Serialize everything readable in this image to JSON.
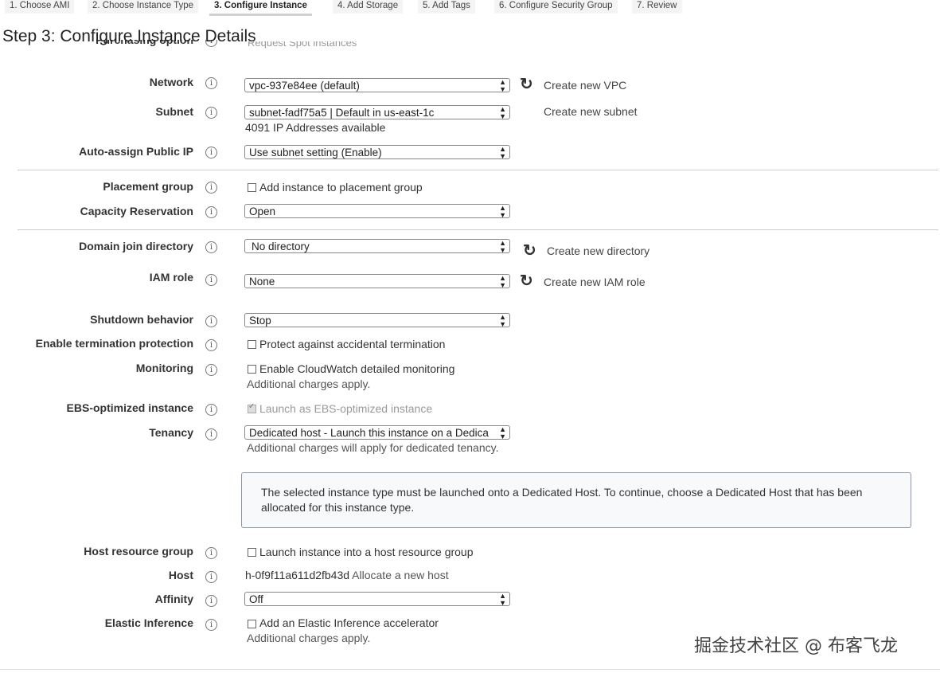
{
  "tabs": [
    {
      "label": "1. Choose AMI"
    },
    {
      "label": "2. Choose Instance Type"
    },
    {
      "label": "3. Configure Instance"
    },
    {
      "label": "4. Add Storage"
    },
    {
      "label": "5. Add Tags"
    },
    {
      "label": "6. Configure Security Group"
    },
    {
      "label": "7. Review"
    }
  ],
  "page": {
    "title": "Step 3: Configure Instance Details",
    "cut_label": "Purchasing option",
    "cut_checkbox": "Request Spot instances"
  },
  "network": {
    "label": "Network",
    "value": "vpc-937e84ee (default)",
    "link": "Create new VPC"
  },
  "subnet": {
    "label": "Subnet",
    "value": "subnet-fadf75a5 | Default in us-east-1c",
    "link": "Create new subnet",
    "note": "4091 IP Addresses available"
  },
  "public_ip": {
    "label": "Auto-assign Public IP",
    "value": "Use subnet setting (Enable)"
  },
  "placement": {
    "label": "Placement group",
    "checkbox": "Add instance to placement group"
  },
  "capacity": {
    "label": "Capacity Reservation",
    "value": "Open"
  },
  "domain": {
    "label": "Domain join directory",
    "value": "No directory",
    "link": "Create new directory"
  },
  "iam": {
    "label": "IAM role",
    "value": "None",
    "link": "Create new IAM role"
  },
  "shutdown": {
    "label": "Shutdown behavior",
    "value": "Stop"
  },
  "termination": {
    "label": "Enable termination protection",
    "checkbox": "Protect against accidental termination"
  },
  "monitoring": {
    "label": "Monitoring",
    "checkbox": "Enable CloudWatch detailed monitoring",
    "note": "Additional charges apply."
  },
  "ebs": {
    "label": "EBS-optimized instance",
    "checkbox": "Launch as EBS-optimized instance",
    "checked": true
  },
  "tenancy": {
    "label": "Tenancy",
    "value": "Dedicated host - Launch this instance on a Dedica",
    "note": "Additional charges will apply for dedicated tenancy."
  },
  "alert": {
    "text": "The selected instance type must be launched onto a Dedicated Host. To continue, choose a Dedicated Host that has been allocated for this instance type."
  },
  "host_group": {
    "label": "Host resource group",
    "checkbox": "Launch instance into a host resource group"
  },
  "host": {
    "label": "Host",
    "value": "h-0f9f11a611d2fb43d",
    "link": "Allocate a new host"
  },
  "affinity": {
    "label": "Affinity",
    "value": "Off"
  },
  "inference": {
    "label": "Elastic Inference",
    "checkbox": "Add an Elastic Inference accelerator",
    "note": "Additional charges apply."
  },
  "watermark": "掘金技术社区 @ 布客飞龙",
  "icons": {
    "info": "info-icon",
    "refresh": "refresh-icon",
    "dropdown": "dropdown-arrow-icon"
  }
}
